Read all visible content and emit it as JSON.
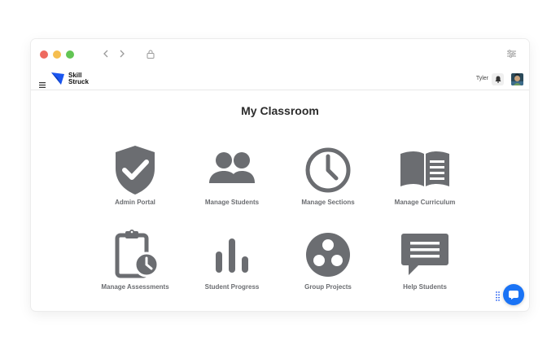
{
  "app": {
    "logo_line1": "Skill",
    "logo_line2": "Struck",
    "brand_color": "#1a56f0"
  },
  "user": {
    "name": "Tyler"
  },
  "page": {
    "title": "My Classroom"
  },
  "tiles": [
    {
      "label": "Admin Portal",
      "icon": "shield-check-icon"
    },
    {
      "label": "Manage Students",
      "icon": "people-icon"
    },
    {
      "label": "Manage Sections",
      "icon": "clock-icon"
    },
    {
      "label": "Manage Curriculum",
      "icon": "book-icon"
    },
    {
      "label": "Manage Assessments",
      "icon": "clipboard-clock-icon"
    },
    {
      "label": "Student Progress",
      "icon": "bar-chart-icon"
    },
    {
      "label": "Group Projects",
      "icon": "group-circle-icon"
    },
    {
      "label": "Help Students",
      "icon": "chat-bubble-icon"
    }
  ],
  "colors": {
    "icon_gray": "#6b6d71",
    "chat_fab": "#1a73f5"
  }
}
